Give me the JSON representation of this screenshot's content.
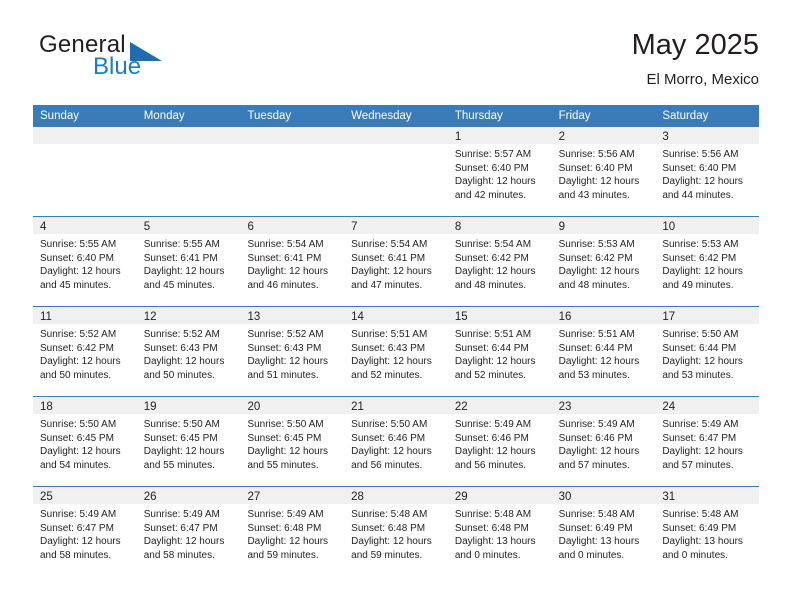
{
  "brand": {
    "name_top": "General",
    "name_bottom": "Blue",
    "flag_icon": "triangle-flag-icon",
    "accent_color": "#2079c7"
  },
  "header": {
    "title": "May 2025",
    "subtitle": "El Morro, Mexico"
  },
  "theme": {
    "header_blue": "#3a7cba",
    "day_band_gray": "#f0f0f0",
    "text_dark": "#231f20"
  },
  "calendar": {
    "weekdays": [
      "Sunday",
      "Monday",
      "Tuesday",
      "Wednesday",
      "Thursday",
      "Friday",
      "Saturday"
    ],
    "weeks": [
      [
        {
          "day": "",
          "lines": []
        },
        {
          "day": "",
          "lines": []
        },
        {
          "day": "",
          "lines": []
        },
        {
          "day": "",
          "lines": []
        },
        {
          "day": "1",
          "lines": [
            "Sunrise: 5:57 AM",
            "Sunset: 6:40 PM",
            "Daylight: 12 hours",
            "and 42 minutes."
          ]
        },
        {
          "day": "2",
          "lines": [
            "Sunrise: 5:56 AM",
            "Sunset: 6:40 PM",
            "Daylight: 12 hours",
            "and 43 minutes."
          ]
        },
        {
          "day": "3",
          "lines": [
            "Sunrise: 5:56 AM",
            "Sunset: 6:40 PM",
            "Daylight: 12 hours",
            "and 44 minutes."
          ]
        }
      ],
      [
        {
          "day": "4",
          "lines": [
            "Sunrise: 5:55 AM",
            "Sunset: 6:40 PM",
            "Daylight: 12 hours",
            "and 45 minutes."
          ]
        },
        {
          "day": "5",
          "lines": [
            "Sunrise: 5:55 AM",
            "Sunset: 6:41 PM",
            "Daylight: 12 hours",
            "and 45 minutes."
          ]
        },
        {
          "day": "6",
          "lines": [
            "Sunrise: 5:54 AM",
            "Sunset: 6:41 PM",
            "Daylight: 12 hours",
            "and 46 minutes."
          ]
        },
        {
          "day": "7",
          "lines": [
            "Sunrise: 5:54 AM",
            "Sunset: 6:41 PM",
            "Daylight: 12 hours",
            "and 47 minutes."
          ]
        },
        {
          "day": "8",
          "lines": [
            "Sunrise: 5:54 AM",
            "Sunset: 6:42 PM",
            "Daylight: 12 hours",
            "and 48 minutes."
          ]
        },
        {
          "day": "9",
          "lines": [
            "Sunrise: 5:53 AM",
            "Sunset: 6:42 PM",
            "Daylight: 12 hours",
            "and 48 minutes."
          ]
        },
        {
          "day": "10",
          "lines": [
            "Sunrise: 5:53 AM",
            "Sunset: 6:42 PM",
            "Daylight: 12 hours",
            "and 49 minutes."
          ]
        }
      ],
      [
        {
          "day": "11",
          "lines": [
            "Sunrise: 5:52 AM",
            "Sunset: 6:42 PM",
            "Daylight: 12 hours",
            "and 50 minutes."
          ]
        },
        {
          "day": "12",
          "lines": [
            "Sunrise: 5:52 AM",
            "Sunset: 6:43 PM",
            "Daylight: 12 hours",
            "and 50 minutes."
          ]
        },
        {
          "day": "13",
          "lines": [
            "Sunrise: 5:52 AM",
            "Sunset: 6:43 PM",
            "Daylight: 12 hours",
            "and 51 minutes."
          ]
        },
        {
          "day": "14",
          "lines": [
            "Sunrise: 5:51 AM",
            "Sunset: 6:43 PM",
            "Daylight: 12 hours",
            "and 52 minutes."
          ]
        },
        {
          "day": "15",
          "lines": [
            "Sunrise: 5:51 AM",
            "Sunset: 6:44 PM",
            "Daylight: 12 hours",
            "and 52 minutes."
          ]
        },
        {
          "day": "16",
          "lines": [
            "Sunrise: 5:51 AM",
            "Sunset: 6:44 PM",
            "Daylight: 12 hours",
            "and 53 minutes."
          ]
        },
        {
          "day": "17",
          "lines": [
            "Sunrise: 5:50 AM",
            "Sunset: 6:44 PM",
            "Daylight: 12 hours",
            "and 53 minutes."
          ]
        }
      ],
      [
        {
          "day": "18",
          "lines": [
            "Sunrise: 5:50 AM",
            "Sunset: 6:45 PM",
            "Daylight: 12 hours",
            "and 54 minutes."
          ]
        },
        {
          "day": "19",
          "lines": [
            "Sunrise: 5:50 AM",
            "Sunset: 6:45 PM",
            "Daylight: 12 hours",
            "and 55 minutes."
          ]
        },
        {
          "day": "20",
          "lines": [
            "Sunrise: 5:50 AM",
            "Sunset: 6:45 PM",
            "Daylight: 12 hours",
            "and 55 minutes."
          ]
        },
        {
          "day": "21",
          "lines": [
            "Sunrise: 5:50 AM",
            "Sunset: 6:46 PM",
            "Daylight: 12 hours",
            "and 56 minutes."
          ]
        },
        {
          "day": "22",
          "lines": [
            "Sunrise: 5:49 AM",
            "Sunset: 6:46 PM",
            "Daylight: 12 hours",
            "and 56 minutes."
          ]
        },
        {
          "day": "23",
          "lines": [
            "Sunrise: 5:49 AM",
            "Sunset: 6:46 PM",
            "Daylight: 12 hours",
            "and 57 minutes."
          ]
        },
        {
          "day": "24",
          "lines": [
            "Sunrise: 5:49 AM",
            "Sunset: 6:47 PM",
            "Daylight: 12 hours",
            "and 57 minutes."
          ]
        }
      ],
      [
        {
          "day": "25",
          "lines": [
            "Sunrise: 5:49 AM",
            "Sunset: 6:47 PM",
            "Daylight: 12 hours",
            "and 58 minutes."
          ]
        },
        {
          "day": "26",
          "lines": [
            "Sunrise: 5:49 AM",
            "Sunset: 6:47 PM",
            "Daylight: 12 hours",
            "and 58 minutes."
          ]
        },
        {
          "day": "27",
          "lines": [
            "Sunrise: 5:49 AM",
            "Sunset: 6:48 PM",
            "Daylight: 12 hours",
            "and 59 minutes."
          ]
        },
        {
          "day": "28",
          "lines": [
            "Sunrise: 5:48 AM",
            "Sunset: 6:48 PM",
            "Daylight: 12 hours",
            "and 59 minutes."
          ]
        },
        {
          "day": "29",
          "lines": [
            "Sunrise: 5:48 AM",
            "Sunset: 6:48 PM",
            "Daylight: 13 hours",
            "and 0 minutes."
          ]
        },
        {
          "day": "30",
          "lines": [
            "Sunrise: 5:48 AM",
            "Sunset: 6:49 PM",
            "Daylight: 13 hours",
            "and 0 minutes."
          ]
        },
        {
          "day": "31",
          "lines": [
            "Sunrise: 5:48 AM",
            "Sunset: 6:49 PM",
            "Daylight: 13 hours",
            "and 0 minutes."
          ]
        }
      ]
    ]
  }
}
